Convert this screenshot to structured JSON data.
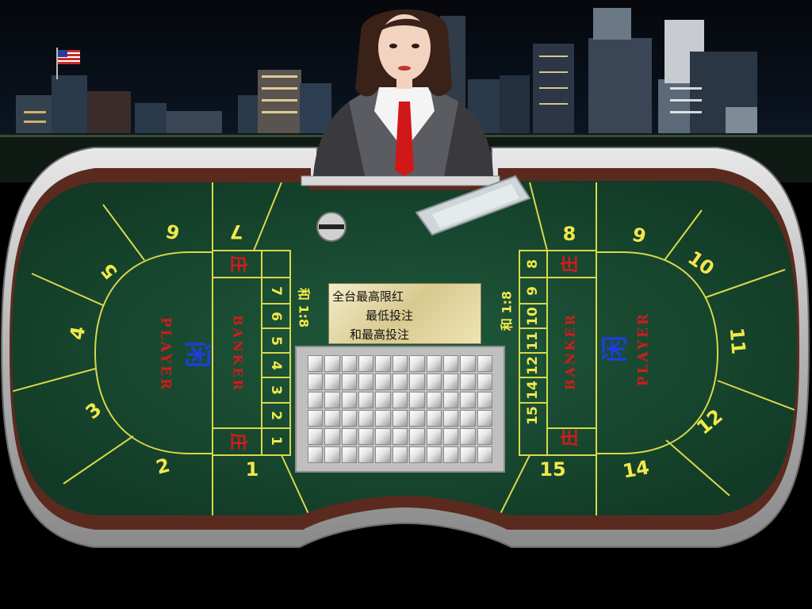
{
  "table": {
    "left_seats": [
      "1",
      "2",
      "3",
      "4",
      "5",
      "6",
      "7"
    ],
    "right_seats": [
      "8",
      "9",
      "10",
      "11",
      "12",
      "14",
      "15"
    ],
    "left_pair_numbers": [
      "7",
      "6",
      "5",
      "4",
      "3",
      "2",
      "1"
    ],
    "right_pair_numbers": [
      "8",
      "9",
      "10",
      "11",
      "12",
      "14",
      "15"
    ],
    "banker_label": "BANKER",
    "player_label": "PLAYER",
    "banker_char": "庄",
    "player_char": "闲",
    "tie_label": "和 1:8"
  },
  "limits": {
    "line1": "全台最高限红",
    "line2": "最低投注",
    "line3": "和最高投注"
  },
  "colors": {
    "felt": "#1a4d33",
    "rail": "#c8c8c8",
    "line": "#d8d84a",
    "banker": "#d41b1b",
    "player": "#1d3fd6"
  }
}
